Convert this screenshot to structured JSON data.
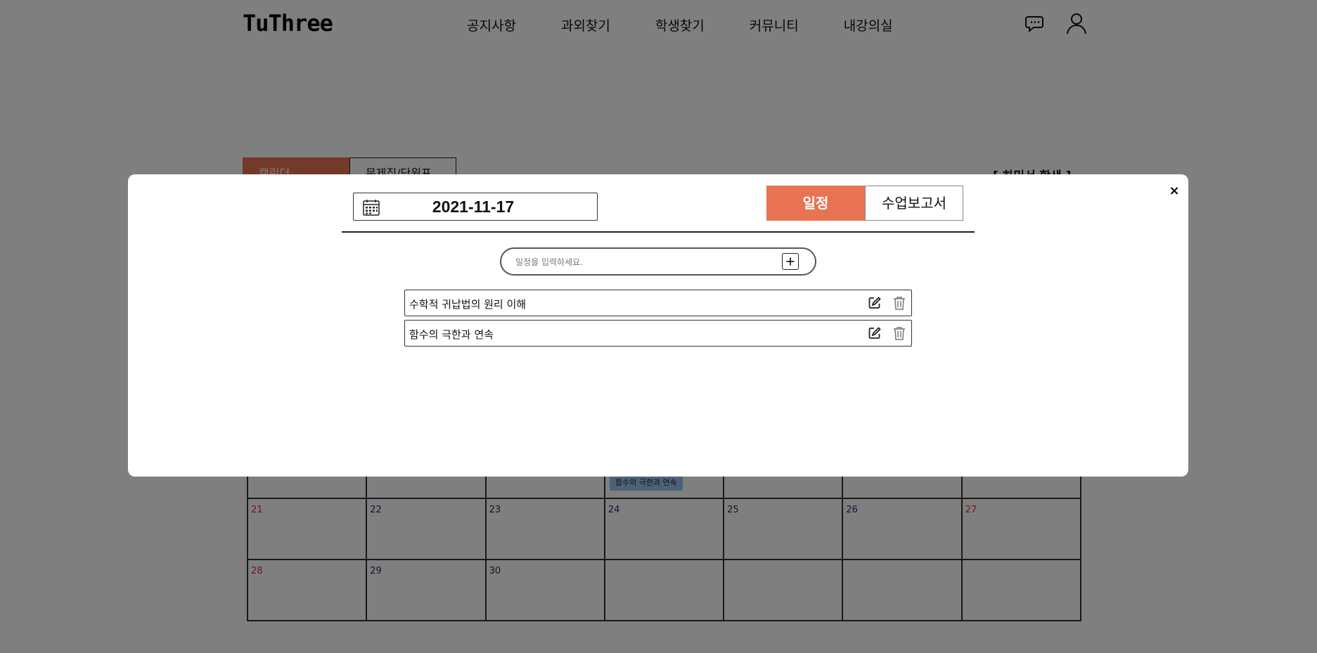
{
  "header": {
    "logo": "TuThree",
    "nav": [
      "공지사항",
      "과외찾기",
      "학생찾기",
      "커뮤니티",
      "내강의실"
    ],
    "icons": [
      "chat-icon",
      "user-icon"
    ]
  },
  "background": {
    "tabs": [
      "캘린더",
      "문제집/단원표"
    ],
    "student_name": "[ 하민서 학생 ]",
    "calendar": {
      "rows": [
        [
          "",
          "",
          "",
          "",
          "",
          "",
          ""
        ],
        [
          "21",
          "22",
          "23",
          "24",
          "25",
          "26",
          "27"
        ],
        [
          "28",
          "29",
          "30",
          "",
          "",
          "",
          ""
        ]
      ],
      "red_dates": [
        "21",
        "27",
        "28"
      ],
      "event": "함수의 극한과 연속"
    }
  },
  "modal": {
    "close_label": "×",
    "date": "2021-11-17",
    "tabs": {
      "schedule": "일정",
      "report": "수업보고서"
    },
    "input_placeholder": "일정을 입력하세요.",
    "items": [
      {
        "text": "수학적 귀납법의 원리 이해"
      },
      {
        "text": "함수의 극한과 연속"
      }
    ]
  },
  "colors": {
    "accent": "#e77352",
    "event_bg": "#9ac4f2",
    "overlay": "rgba(0,0,0,0.5)"
  }
}
